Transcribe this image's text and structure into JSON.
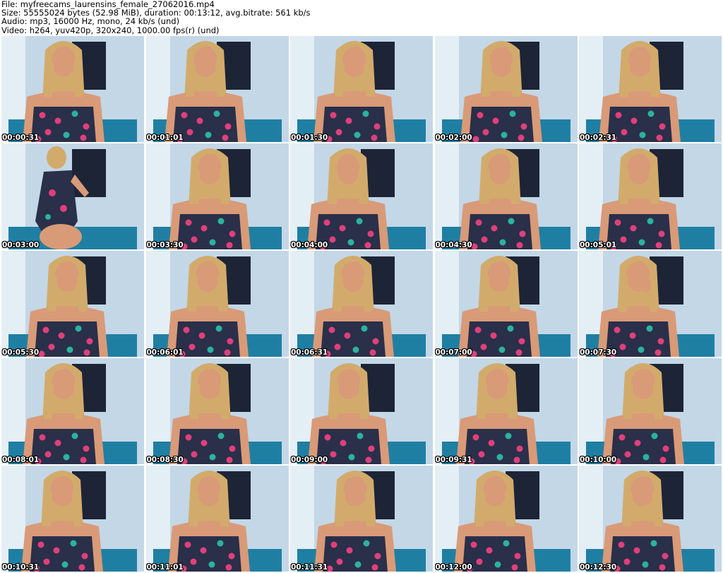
{
  "header": {
    "file_line": "File: myfreecams_laurensins_female_27062016.mp4",
    "size_line": "Size: 55555024 bytes (52.98 MiB), duration: 00:13:12, avg.bitrate: 561 kb/s",
    "audio_line": "Audio: mp3, 16000 Hz, mono, 24 kb/s (und)",
    "video_line": "Video: h264, yuv420p, 320x240, 1000.00 fps(r) (und)"
  },
  "thumbnails": [
    {
      "timestamp": "00:00:31"
    },
    {
      "timestamp": "00:01:01"
    },
    {
      "timestamp": "00:01:30"
    },
    {
      "timestamp": "00:02:00"
    },
    {
      "timestamp": "00:02:31"
    },
    {
      "timestamp": "00:03:00"
    },
    {
      "timestamp": "00:03:30"
    },
    {
      "timestamp": "00:04:00"
    },
    {
      "timestamp": "00:04:30"
    },
    {
      "timestamp": "00:05:01"
    },
    {
      "timestamp": "00:05:30"
    },
    {
      "timestamp": "00:06:01"
    },
    {
      "timestamp": "00:06:31"
    },
    {
      "timestamp": "00:07:00"
    },
    {
      "timestamp": "00:07:30"
    },
    {
      "timestamp": "00:08:01"
    },
    {
      "timestamp": "00:08:30"
    },
    {
      "timestamp": "00:09:00"
    },
    {
      "timestamp": "00:09:31"
    },
    {
      "timestamp": "00:10:00"
    },
    {
      "timestamp": "00:10:31"
    },
    {
      "timestamp": "00:11:01"
    },
    {
      "timestamp": "00:11:31"
    },
    {
      "timestamp": "00:12:00"
    },
    {
      "timestamp": "00:12:30"
    }
  ],
  "colors": {
    "wall": "#c3d7e6",
    "wall_light": "#e4eef5",
    "poster": "#1c2436",
    "chair": "#1f7fa3",
    "hair": "#d2ab6c",
    "skin": "#d99a78",
    "dress": "#2a2f4a",
    "flower": "#e0407a",
    "leaf": "#2bb39b"
  }
}
